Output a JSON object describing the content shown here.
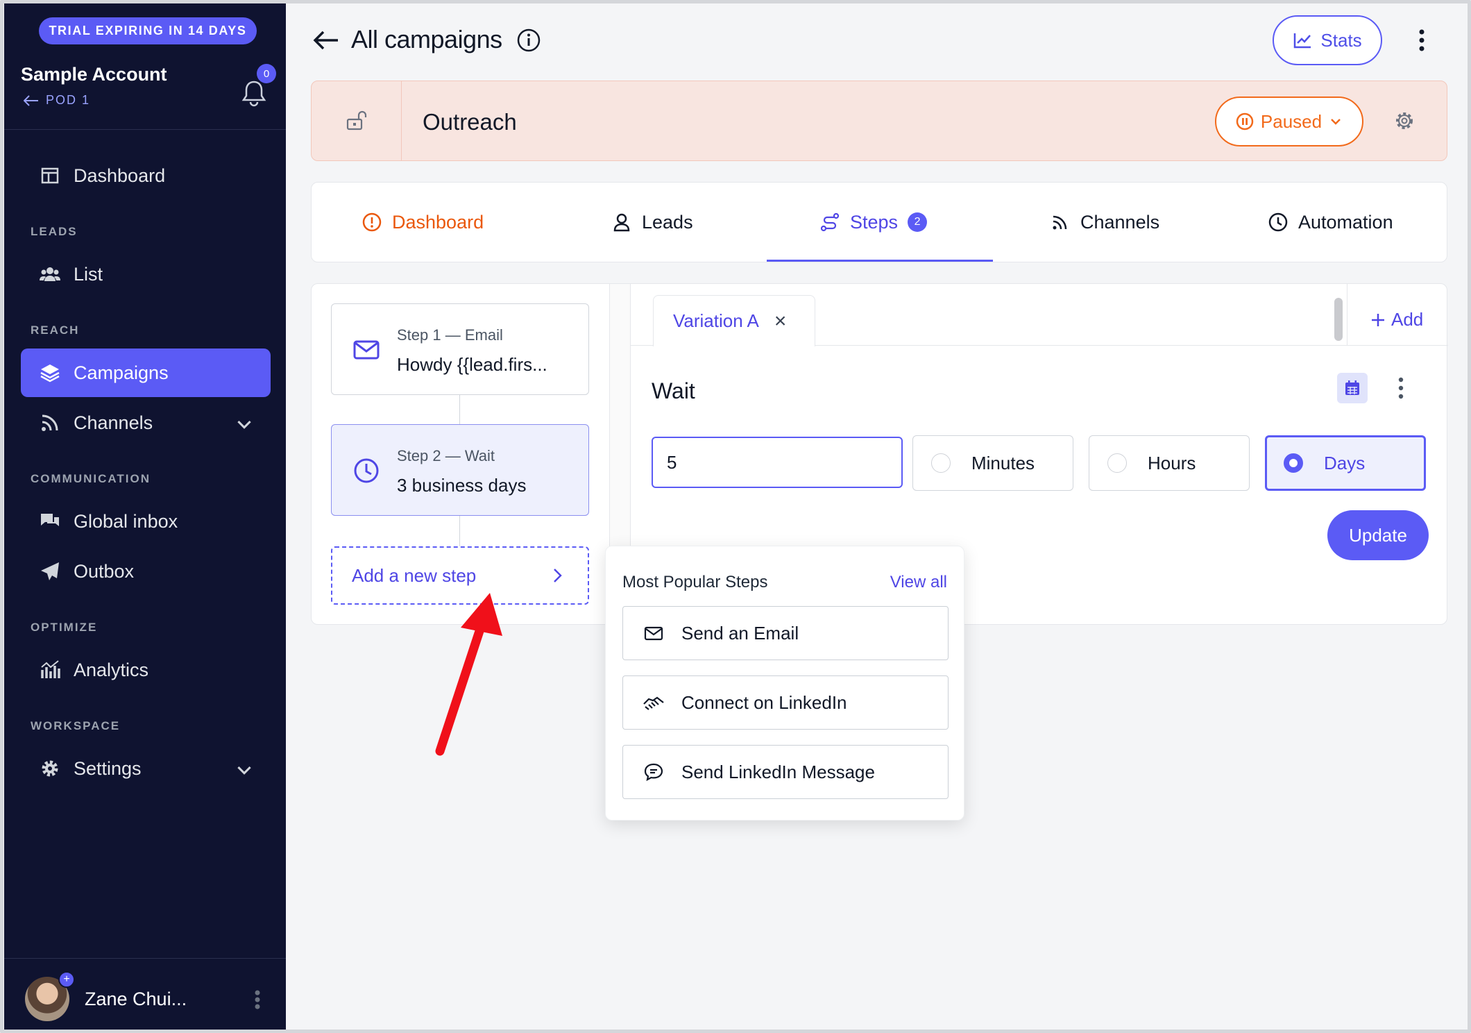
{
  "sidebar": {
    "trial_badge": "TRIAL EXPIRING IN 14 DAYS",
    "account_name": "Sample Account",
    "pod_label": "POD 1",
    "notification_count": "0",
    "sections": {
      "leads": "LEADS",
      "reach": "REACH",
      "communication": "COMMUNICATION",
      "optimize": "OPTIMIZE",
      "workspace": "WORKSPACE"
    },
    "items": {
      "dashboard": "Dashboard",
      "list": "List",
      "campaigns": "Campaigns",
      "channels": "Channels",
      "global_inbox": "Global inbox",
      "outbox": "Outbox",
      "analytics": "Analytics",
      "settings": "Settings"
    },
    "active_item": "Campaigns",
    "user_name": "Zane Chui..."
  },
  "header": {
    "title": "All campaigns",
    "stats_label": "Stats"
  },
  "campaign": {
    "name": "Outreach",
    "status_label": "Paused"
  },
  "tabs": {
    "dashboard": "Dashboard",
    "leads": "Leads",
    "steps": "Steps",
    "steps_count": "2",
    "channels": "Channels",
    "automation": "Automation",
    "active": "Steps"
  },
  "steps": {
    "items": [
      {
        "label": "Step 1 — Email",
        "title": "Howdy {{lead.firs...",
        "icon": "envelope-icon"
      },
      {
        "label": "Step 2 — Wait",
        "title": "3 business days",
        "icon": "clock-icon"
      }
    ],
    "add_label": "Add a new step"
  },
  "editor": {
    "variation_tab": "Variation A",
    "add_label": "Add",
    "section_title": "Wait",
    "wait_value": "5",
    "units": [
      "Minutes",
      "Hours",
      "Days"
    ],
    "selected_unit": "Days",
    "update_label": "Update"
  },
  "popup": {
    "title": "Most Popular Steps",
    "view_all": "View all",
    "items": [
      {
        "label": "Send an Email",
        "icon": "envelope-icon"
      },
      {
        "label": "Connect on LinkedIn",
        "icon": "handshake-icon"
      },
      {
        "label": "Send LinkedIn Message",
        "icon": "message-icon"
      }
    ]
  },
  "colors": {
    "accent": "#5b5bf5",
    "sidebar_bg": "#0f1330",
    "paused_orange": "#f26a1b",
    "campaign_bar_bg": "#f8e5e0",
    "annotation_arrow": "#f0101a"
  }
}
